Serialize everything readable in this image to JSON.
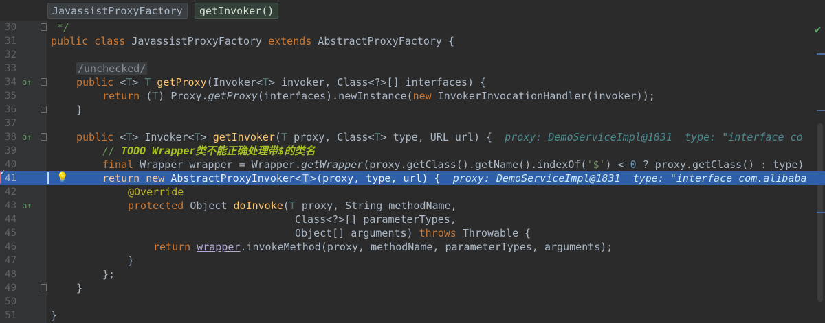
{
  "breadcrumb": {
    "class_name": "JavassistProxyFactory",
    "method_name": "getInvoker()"
  },
  "icons": {
    "override": "override-marker-icon",
    "breakpoint": "breakpoint-icon",
    "fold": "fold-marker-icon",
    "bulb": "intention-bulb-icon",
    "check": "inspection-ok-icon"
  },
  "colors": {
    "keyword": "#cc7832",
    "method": "#ffc66d",
    "comment": "#629755",
    "current_line": "#2e5fa8",
    "breakpoint": "#c9495a"
  },
  "lines": [
    {
      "num": "30",
      "t": {
        "a": " */"
      }
    },
    {
      "num": "31",
      "t": {
        "k1": "public class ",
        "c1": "JavassistProxyFactory ",
        "k2": "extends ",
        "c2": "AbstractProxyFactory {"
      }
    },
    {
      "num": "32"
    },
    {
      "num": "33",
      "t": {
        "fold": "/unchecked/"
      }
    },
    {
      "num": "34",
      "t": {
        "k1": "public ",
        "c1": "<",
        "g1": "T",
        "c2": "> ",
        "g2": "T ",
        "f1": "getProxy",
        "c3": "(Invoker<",
        "g3": "T",
        "c4": "> invoker, Class<?>[] interfaces) {"
      }
    },
    {
      "num": "35",
      "t": {
        "k1": "return ",
        "c1": "(",
        "g1": "T",
        "c2": ") Proxy.",
        "i1": "getProxy",
        "c3": "(interfaces).newInstance(",
        "k2": "new ",
        "c4": "InvokerInvocationHandler(invoker));"
      }
    },
    {
      "num": "36",
      "t": {
        "c1": "}"
      }
    },
    {
      "num": "37"
    },
    {
      "num": "38",
      "t": {
        "k1": "public ",
        "c1": "<",
        "g1": "T",
        "c2": "> Invoker<",
        "g2": "T",
        "c3": "> ",
        "f1": "getInvoker",
        "c4": "(",
        "g3": "T ",
        "c5": "proxy, Class<",
        "g4": "T",
        "c6": "> type, URL url) {",
        "h1": "  proxy: DemoServiceImpl@1831  type: \"interface co"
      }
    },
    {
      "num": "39",
      "t": {
        "cm": "// ",
        "todo": "TODO Wrapper类不能正确处理带$的类名"
      }
    },
    {
      "num": "40",
      "t": {
        "k1": "final ",
        "c1": "Wrapper wrapper = Wrapper.",
        "i1": "getWrapper",
        "c2": "(proxy.getClass().getName().indexOf(",
        "s1": "'$'",
        "c3": ") < ",
        "n1": "0",
        "c4": " ? proxy.getClass() : type)"
      }
    },
    {
      "num": "41",
      "t": {
        "k1": "return new ",
        "c1": "AbstractProxyInvoker<",
        "fold": "T",
        "c2": ">(proxy, type, url) {",
        "h1": "  proxy: DemoServiceImpl@1831  type: \"interface com.alibaba"
      }
    },
    {
      "num": "42",
      "t": {
        "an": "@Override"
      }
    },
    {
      "num": "43",
      "t": {
        "k1": "protected ",
        "c1": "Object ",
        "f1": "doInvoke",
        "c2": "(",
        "g1": "T ",
        "c3": "proxy, String methodName,"
      }
    },
    {
      "num": "44",
      "t": {
        "c1": "Class<?>[] parameterTypes,"
      }
    },
    {
      "num": "45",
      "t": {
        "c1": "Object[] arguments) ",
        "k1": "throws ",
        "c2": "Throwable {"
      }
    },
    {
      "num": "46",
      "t": {
        "k1": "return ",
        "l1": "wrapper",
        "c1": ".invokeMethod(proxy, methodName, parameterTypes, arguments);"
      }
    },
    {
      "num": "47",
      "t": {
        "c1": "}"
      }
    },
    {
      "num": "48",
      "t": {
        "c1": "};"
      }
    },
    {
      "num": "49",
      "t": {
        "c1": "}"
      }
    },
    {
      "num": "50"
    },
    {
      "num": "51",
      "t": {
        "c1": "}"
      }
    }
  ]
}
